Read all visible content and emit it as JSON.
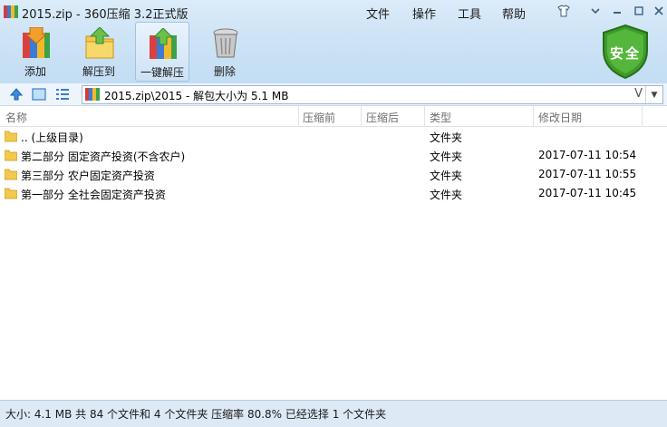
{
  "window": {
    "title": "2015.zip - 360压缩 3.2正式版",
    "menu": [
      "文件",
      "操作",
      "工具",
      "帮助"
    ]
  },
  "toolbar": {
    "add": "添加",
    "extract_to": "解压到",
    "one_click_extract": "一键解压",
    "delete": "删除"
  },
  "security_badge": "安全",
  "address": {
    "path": "2015.zip\\2015 - 解包大小为 5.1 MB",
    "view_mark": "V"
  },
  "columns": {
    "name": "名称",
    "size_before": "压缩前",
    "size_after": "压缩后",
    "type": "类型",
    "modified": "修改日期"
  },
  "rows": [
    {
      "name": ".. (上级目录)",
      "type": "文件夹",
      "date": ""
    },
    {
      "name": "第二部分 固定资产投资(不含农户)",
      "type": "文件夹",
      "date": "2017-07-11 10:54"
    },
    {
      "name": "第三部分 农户固定资产投资",
      "type": "文件夹",
      "date": "2017-07-11 10:55"
    },
    {
      "name": "第一部分 全社会固定资产投资",
      "type": "文件夹",
      "date": "2017-07-11 10:45"
    }
  ],
  "status": "大小: 4.1 MB 共 84 个文件和 4 个文件夹 压缩率 80.8% 已经选择 1 个文件夹",
  "icons": {
    "app": "archive-icon",
    "add": "add-archive-icon",
    "extract": "extract-folder-icon",
    "one_click": "one-click-extract-icon",
    "delete": "trash-icon",
    "shield": "shield-icon",
    "up": "up-arrow-icon",
    "folder": "folder-icon"
  },
  "colors": {
    "accent": "#2f7fd0",
    "shield_green": "#3d9a2c",
    "folder_yellow": "#f2c94c"
  }
}
